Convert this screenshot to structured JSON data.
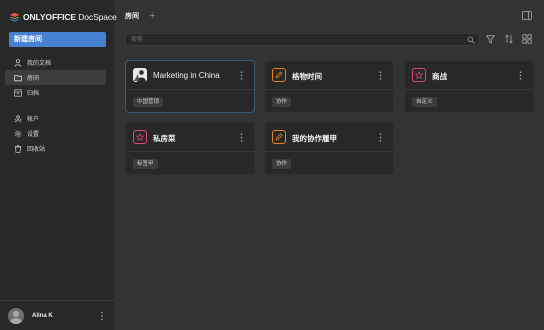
{
  "app": {
    "logo_bold": "ONLYOFFICE",
    "logo_light": "DocSpace"
  },
  "sidebar": {
    "create_button": "新建房间",
    "nav_top": [
      {
        "label": "我的文档",
        "icon": "person-icon",
        "active": false
      },
      {
        "label": "房间",
        "icon": "folder-icon",
        "active": true
      },
      {
        "label": "归档",
        "icon": "archive-icon",
        "active": false
      }
    ],
    "nav_bottom": [
      {
        "label": "帐户",
        "icon": "accounts-icon"
      },
      {
        "label": "设置",
        "icon": "gear-icon"
      },
      {
        "label": "回收站",
        "icon": "trash-icon"
      }
    ],
    "user": {
      "name": "Alina K"
    }
  },
  "header": {
    "title": "房间",
    "add": "+"
  },
  "search": {
    "placeholder": "搜索",
    "value": ""
  },
  "rooms": [
    {
      "title": "Marketing in China",
      "tag": "中国营销",
      "icon": "room-photo-icon",
      "color": "#e4e4e4",
      "selected": true
    },
    {
      "title": "格物时间",
      "tag": "协作",
      "icon": "pencil-icon",
      "color": "#e8821c",
      "selected": false
    },
    {
      "title": "商战",
      "tag": "自定义",
      "icon": "star-icon",
      "color": "#e0467c",
      "selected": false
    },
    {
      "title": "私房菜",
      "tag": "标签甲",
      "icon": "star-icon",
      "color": "#e0467c",
      "selected": false
    },
    {
      "title": "我的协作履甲",
      "tag": "协作",
      "icon": "pencil-icon",
      "color": "#e8821c",
      "selected": false
    }
  ],
  "colors": {
    "accent": "#4781d1",
    "background": "#333333",
    "sidebar": "#282828",
    "card": "#282828"
  }
}
